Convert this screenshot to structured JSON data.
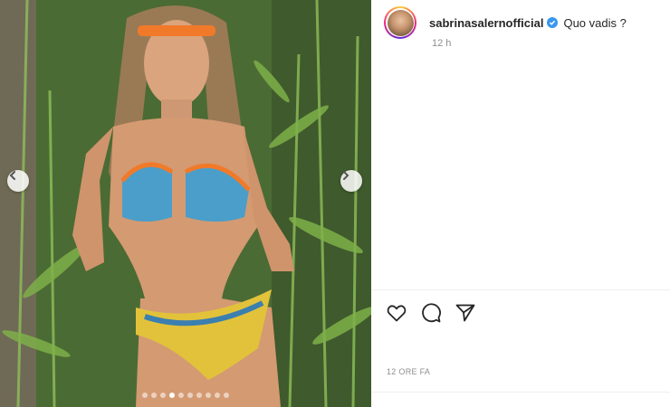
{
  "post": {
    "username": "sabrinasalernofficial",
    "caption": "Quo vadis ?",
    "time_ago": "12 h",
    "date_label": "12 ORE FA",
    "verified": true
  },
  "carousel": {
    "slide_count": 10,
    "active_index": 3
  },
  "icons": {
    "like": "heart-icon",
    "comment": "comment-icon",
    "share": "paper-plane-icon",
    "prev": "chevron-left-icon",
    "next": "chevron-right-icon",
    "verified": "verified-badge-icon"
  },
  "colors": {
    "verified_blue": "#3897f0",
    "text": "#262626",
    "muted": "#8e8e8e"
  }
}
